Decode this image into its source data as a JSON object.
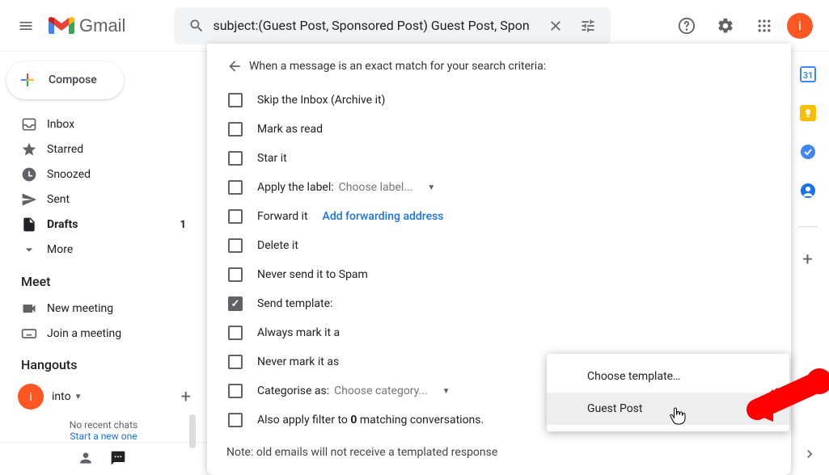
{
  "header": {
    "logo_text": "Gmail",
    "search_value": "subject:(Guest Post, Sponsored Post) Guest Post, Spon",
    "avatar_letter": "i"
  },
  "compose_label": "Compose",
  "nav": [
    {
      "icon": "inbox",
      "label": "Inbox",
      "count": "",
      "bold": false
    },
    {
      "icon": "star",
      "label": "Starred",
      "count": "",
      "bold": false
    },
    {
      "icon": "clock",
      "label": "Snoozed",
      "count": "",
      "bold": false
    },
    {
      "icon": "send",
      "label": "Sent",
      "count": "",
      "bold": false
    },
    {
      "icon": "file",
      "label": "Drafts",
      "count": "1",
      "bold": true
    },
    {
      "icon": "expand",
      "label": "More",
      "count": "",
      "bold": false
    }
  ],
  "meet": {
    "title": "Meet",
    "new_meeting": "New meeting",
    "join_meeting": "Join a meeting"
  },
  "hangouts": {
    "title": "Hangouts",
    "user": "into",
    "avatar_letter": "i",
    "no_chats": "No recent chats",
    "start_new": "Start a new one"
  },
  "filter": {
    "header": "When a message is an exact match for your search criteria:",
    "skip_inbox": "Skip the Inbox (Archive it)",
    "mark_read": "Mark as read",
    "star_it": "Star it",
    "apply_label": "Apply the label:",
    "choose_label": "Choose label...",
    "forward_it": "Forward it",
    "add_forward": "Add forwarding address",
    "delete_it": "Delete it",
    "never_spam": "Never send it to Spam",
    "send_template": "Send template:",
    "always_important": "Always mark it a",
    "never_important": "Never mark it as",
    "categorise": "Categorise as:",
    "choose_category": "Choose category...",
    "also_apply_pre": "Also apply filter to ",
    "also_apply_count": "0",
    "also_apply_post": " matching conversations.",
    "note": "Note: old emails will not receive a templated response"
  },
  "template_menu": {
    "choose": "Choose template…",
    "option1": "Guest Post"
  }
}
